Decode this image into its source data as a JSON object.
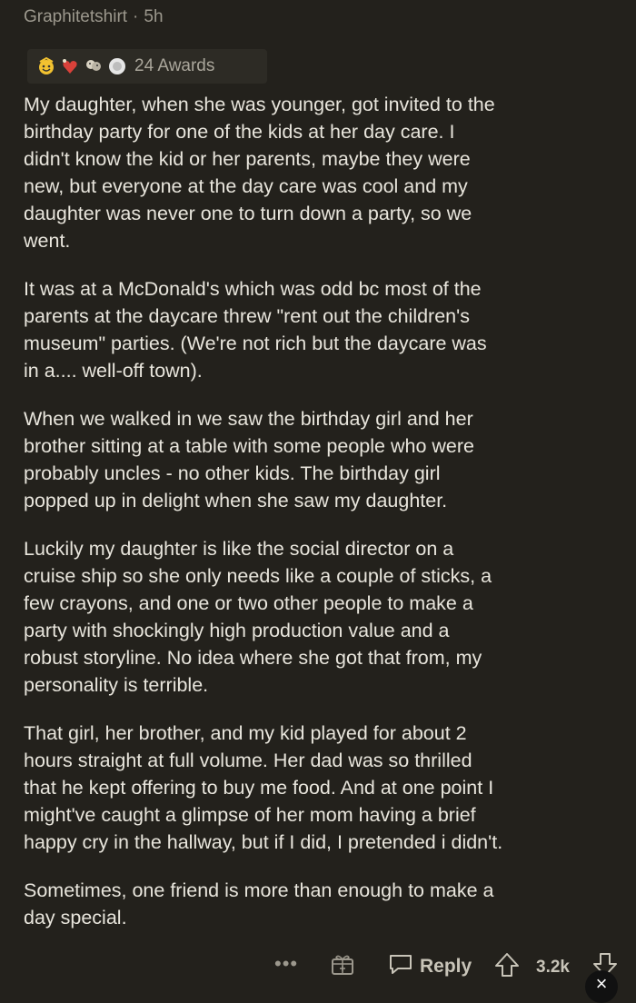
{
  "header": {
    "username": "Graphitetshirt",
    "separator": "·",
    "time": "5h"
  },
  "awards": {
    "label": "24 Awards",
    "icons": [
      "wholesome-award-icon",
      "heart-award-icon",
      "hug-award-icon",
      "silver-award-icon"
    ]
  },
  "comment": {
    "paragraphs": [
      "My daughter, when she was younger, got invited to the\nbirthday party for one of the kids at her day care. I\ndidn't know the kid or her parents, maybe they were\nnew,  but everyone at the day care was cool and my\ndaughter was never one to turn down a party, so we\nwent.",
      "It was at a McDonald's which was odd bc most of the\nparents at the daycare threw \"rent out the children's\nmuseum\" parties. (We're not rich but the daycare was\nin a.... well-off town).",
      "When we walked in we saw the birthday girl and her\nbrother sitting at a table with some people who were\nprobably uncles - no other kids. The birthday girl\npopped up in delight when she saw my daughter.",
      "Luckily my daughter is like the social director on a\ncruise ship so she only needs like a couple of sticks, a\nfew crayons, and one or two other people to make a\nparty with shockingly high production value and a\nrobust storyline. No idea where she got that from, my\npersonality is terrible.",
      "That girl, her brother, and my kid played for about 2\nhours straight at full volume. Her dad was so thrilled\nthat he kept offering to buy me food. And at one point I\nmight've caught a glimpse of her mom having a brief\nhappy cry in the hallway, but if I did, I pretended i didn't.",
      "Sometimes, one friend is more than enough to make a\nday special."
    ]
  },
  "actions": {
    "more": "•••",
    "reply_label": "Reply",
    "votes": "3.2k",
    "close": "×"
  },
  "colors": {
    "background": "#23211c",
    "text": "#e8e5dc",
    "muted": "#9c988d"
  }
}
